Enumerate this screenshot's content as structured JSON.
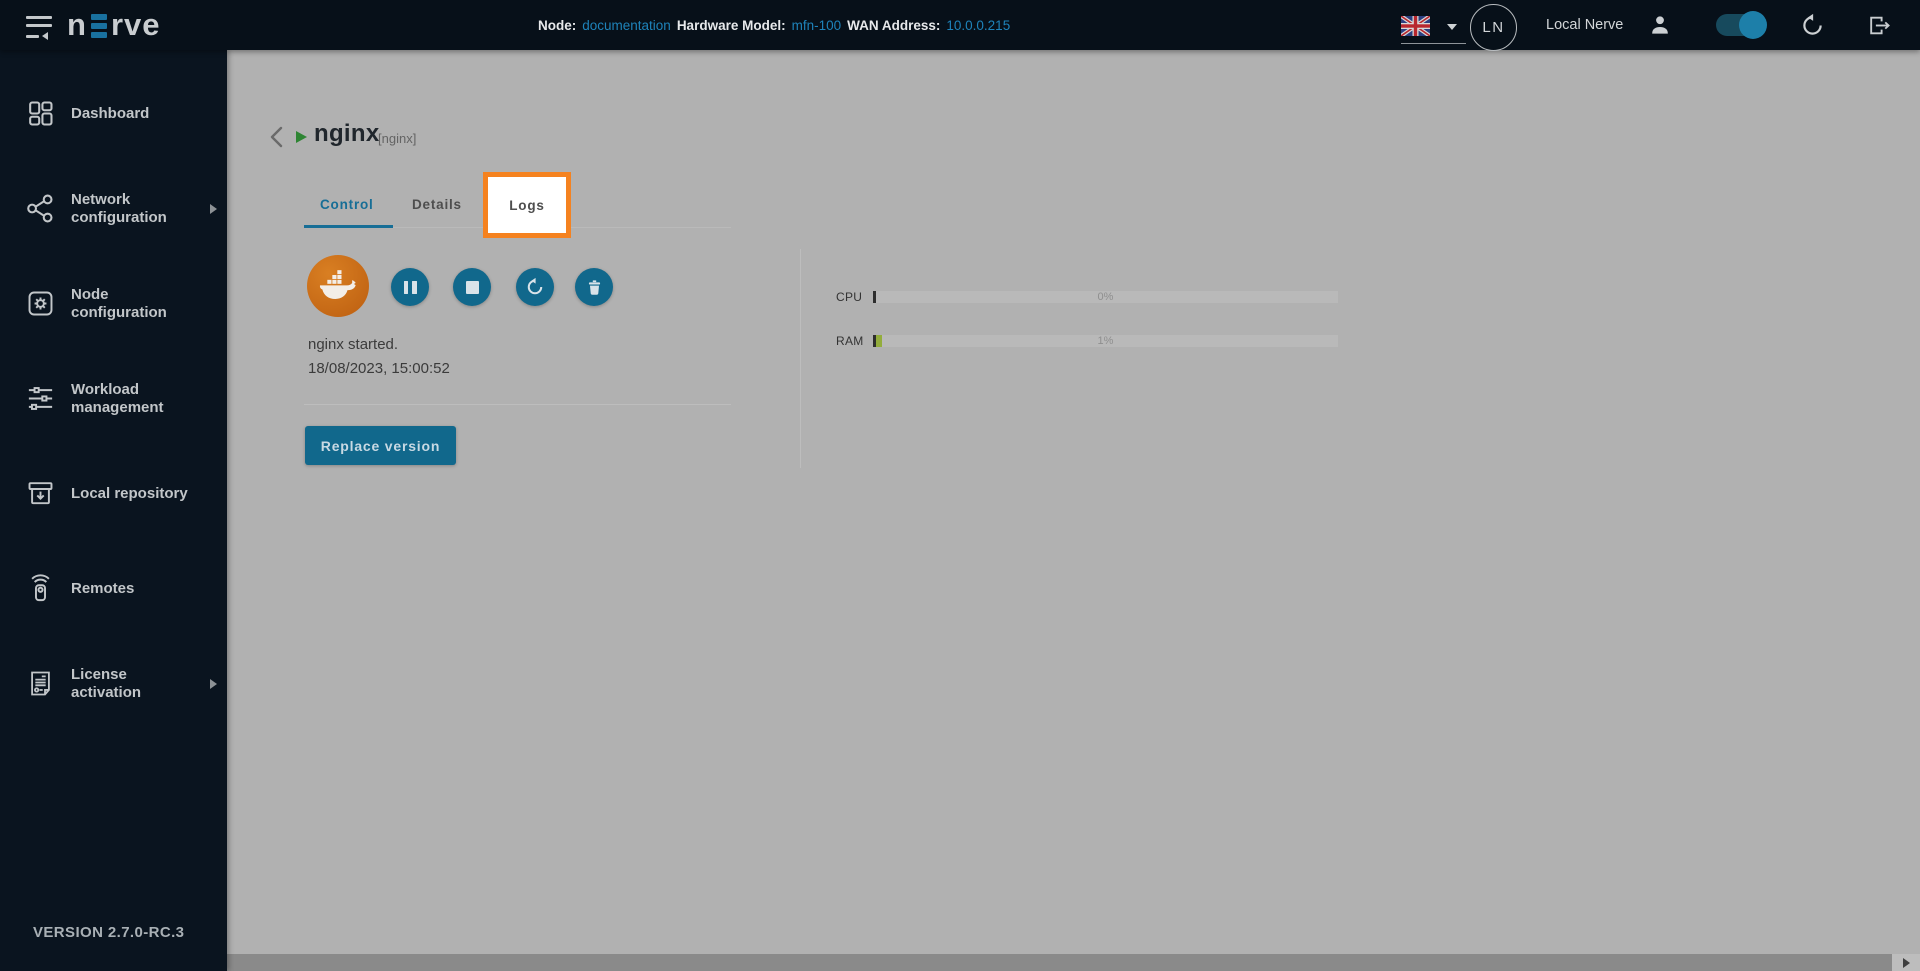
{
  "topbar": {
    "logo_prefix": "n",
    "logo_suffix": "rve",
    "node": {
      "label": "Node:",
      "value": "documentation"
    },
    "hardware": {
      "label": "Hardware Model:",
      "value": "mfn-100"
    },
    "wan": {
      "label": "WAN Address:",
      "value": "10.0.0.215"
    },
    "avatar_initials": "LN",
    "user_name": "Local Nerve"
  },
  "sidebar": {
    "items": [
      {
        "label": "Dashboard",
        "expandable": false
      },
      {
        "label": "Network configuration",
        "expandable": true
      },
      {
        "label": "Node configuration",
        "expandable": false
      },
      {
        "label": "Workload management",
        "expandable": false
      },
      {
        "label": "Local repository",
        "expandable": false
      },
      {
        "label": "Remotes",
        "expandable": false
      },
      {
        "label": "License activation",
        "expandable": true
      }
    ],
    "version": "VERSION 2.7.0-RC.3"
  },
  "workload": {
    "name": "nginx",
    "tag": "[nginx]",
    "status_message": "nginx started.",
    "status_timestamp": "18/08/2023, 15:00:52",
    "replace_button_label": "Replace version"
  },
  "tabs": [
    {
      "label": "Control",
      "active": true,
      "highlighted": false
    },
    {
      "label": "Details",
      "active": false,
      "highlighted": false
    },
    {
      "label": "Logs",
      "active": false,
      "highlighted": true
    }
  ],
  "stats": [
    {
      "label": "CPU",
      "value": "0%",
      "fill": "0%"
    },
    {
      "label": "RAM",
      "value": "1%",
      "fill": "1.3%"
    }
  ],
  "colors": {
    "topbar_bg": "#071019",
    "sidebar_bg": "#0a141f",
    "dimmed_page_bg": "#b1b1b1",
    "accent_blue": "#1e83ba",
    "active_tab_blue": "#176e96",
    "action_button_blue": "#11688c",
    "highlight_orange": "#f5821f",
    "running_green": "#2e8533",
    "ram_bar_green": "#93ad3c",
    "docker_orange": "#c96a17"
  }
}
